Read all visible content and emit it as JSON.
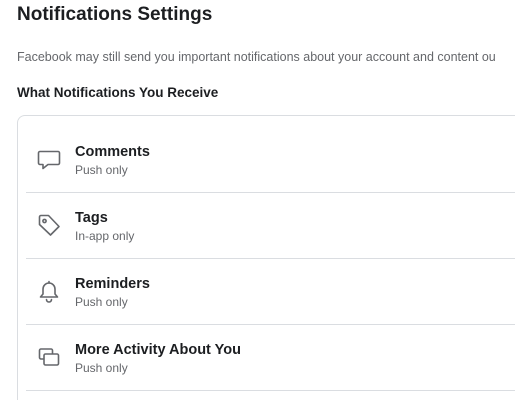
{
  "page": {
    "title": "Notifications Settings",
    "description": "Facebook may still send you important notifications about your account and content ou",
    "section_heading": "What Notifications You Receive"
  },
  "items": [
    {
      "label": "Comments",
      "status": "Push only",
      "icon": "comment-icon"
    },
    {
      "label": "Tags",
      "status": "In-app only",
      "icon": "tag-icon"
    },
    {
      "label": "Reminders",
      "status": "Push only",
      "icon": "bell-icon"
    },
    {
      "label": "More Activity About You",
      "status": "Push only",
      "icon": "activity-icon"
    }
  ],
  "colors": {
    "text_primary": "#1c1e21",
    "text_secondary": "#65676b",
    "divider": "#dadde1",
    "icon": "#65676b"
  }
}
